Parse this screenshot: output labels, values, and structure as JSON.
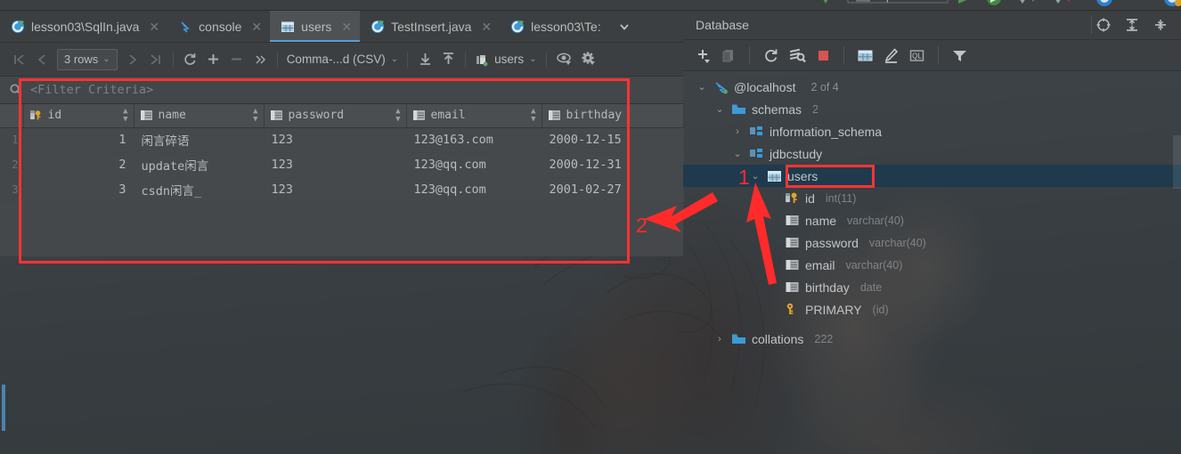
{
  "window": {
    "app": "IntelliJ IDEA Database Tool Window"
  },
  "editor_tabs": [
    {
      "label": "lesson03\\SqlIn.java",
      "icon": "java-class-icon",
      "active": false,
      "closable": true
    },
    {
      "label": "console",
      "icon": "console-query-icon",
      "active": false,
      "closable": true
    },
    {
      "label": "users",
      "icon": "db-table-icon",
      "active": true,
      "closable": true
    },
    {
      "label": "TestInsert.java",
      "icon": "java-class-icon",
      "active": false,
      "closable": true
    },
    {
      "label": "lesson03\\Te:",
      "icon": "java-class-icon",
      "active": false,
      "closable": false
    }
  ],
  "tab_overflow_icon": "chevron-down-icon",
  "grid_toolbar": {
    "first_page": "first-page-icon",
    "prev_page": "prev-page-icon",
    "rows_label": "3 rows",
    "rows_caret": "chevron-down-icon",
    "next_page": "next-page-icon",
    "last_page": "last-page-icon",
    "reload": "refresh-icon",
    "add_row": "plus-icon",
    "remove_row": "minus-icon",
    "more": "double-chevron-right-icon",
    "format_label": "Comma-...d (CSV)",
    "format_caret": "chevron-down-icon",
    "import": "download-icon",
    "export": "upload-icon",
    "datasource_label": "users",
    "datasource_icon": "datasource-icon",
    "datasource_caret": "chevron-down-icon",
    "view_options": "eye-icon",
    "settings": "gear-icon"
  },
  "filter": {
    "icon": "search-filter-icon",
    "placeholder": "<Filter Criteria>"
  },
  "table": {
    "columns": [
      {
        "name": "id",
        "icon": "primary-key-column-icon",
        "sortable": true
      },
      {
        "name": "name",
        "icon": "column-icon",
        "sortable": true
      },
      {
        "name": "password",
        "icon": "column-icon",
        "sortable": true
      },
      {
        "name": "email",
        "icon": "column-icon",
        "sortable": true
      },
      {
        "name": "birthday",
        "icon": "column-icon",
        "sortable": true
      }
    ],
    "rows": [
      {
        "n": "1",
        "id": "1",
        "name": "闲言碎语",
        "password": "123",
        "email": "123@163.com",
        "birthday": "2000-12-15"
      },
      {
        "n": "2",
        "id": "2",
        "name": "update闲言",
        "password": "123",
        "email": "123@qq.com",
        "birthday": "2000-12-31"
      },
      {
        "n": "3",
        "id": "3",
        "name": "csdn闲言_",
        "password": "123",
        "email": "123@qq.com",
        "birthday": "2001-02-27"
      }
    ]
  },
  "database_panel": {
    "title": "Database",
    "header_icons": [
      "locate-icon",
      "expand-all-icon",
      "collapse-all-icon"
    ],
    "toolbar_icons": [
      "add-icon",
      "copy-icon",
      "sync-icon",
      "run-sql-icon",
      "stop-icon",
      "table-editor-icon",
      "edit-icon",
      "query-console-icon",
      "filter-icon"
    ],
    "tree": [
      {
        "depth": 0,
        "twisty": "expanded",
        "icon": "mysql-datasource-icon",
        "label": "@localhost",
        "meta": "2 of 4",
        "selected": false
      },
      {
        "depth": 1,
        "twisty": "expanded",
        "icon": "folder-icon",
        "label": "schemas",
        "meta": "2",
        "selected": false
      },
      {
        "depth": 2,
        "twisty": "collapsed",
        "icon": "schema-icon",
        "label": "information_schema",
        "meta": "",
        "selected": false
      },
      {
        "depth": 2,
        "twisty": "expanded",
        "icon": "schema-icon",
        "label": "jdbcstudy",
        "meta": "",
        "selected": false
      },
      {
        "depth": 3,
        "twisty": "expanded",
        "icon": "db-table-icon",
        "label": "users",
        "meta": "",
        "selected": true
      },
      {
        "depth": 4,
        "twisty": "none",
        "icon": "primary-key-column-icon",
        "label": "id",
        "meta": "int(11)",
        "selected": false
      },
      {
        "depth": 4,
        "twisty": "none",
        "icon": "column-icon",
        "label": "name",
        "meta": "varchar(40)",
        "selected": false
      },
      {
        "depth": 4,
        "twisty": "none",
        "icon": "column-icon",
        "label": "password",
        "meta": "varchar(40)",
        "selected": false
      },
      {
        "depth": 4,
        "twisty": "none",
        "icon": "column-icon",
        "label": "email",
        "meta": "varchar(40)",
        "selected": false
      },
      {
        "depth": 4,
        "twisty": "none",
        "icon": "column-icon",
        "label": "birthday",
        "meta": "date",
        "selected": false
      },
      {
        "depth": 4,
        "twisty": "none",
        "icon": "key-icon",
        "label": "PRIMARY",
        "meta": "(id)",
        "selected": false
      },
      {
        "depth": 1,
        "twisty": "collapsed",
        "icon": "folder-icon",
        "label": "collations",
        "meta": "222",
        "selected": false
      }
    ]
  },
  "annotations": {
    "marker1": "1",
    "marker2": "2",
    "color": "#ff2b2b"
  }
}
